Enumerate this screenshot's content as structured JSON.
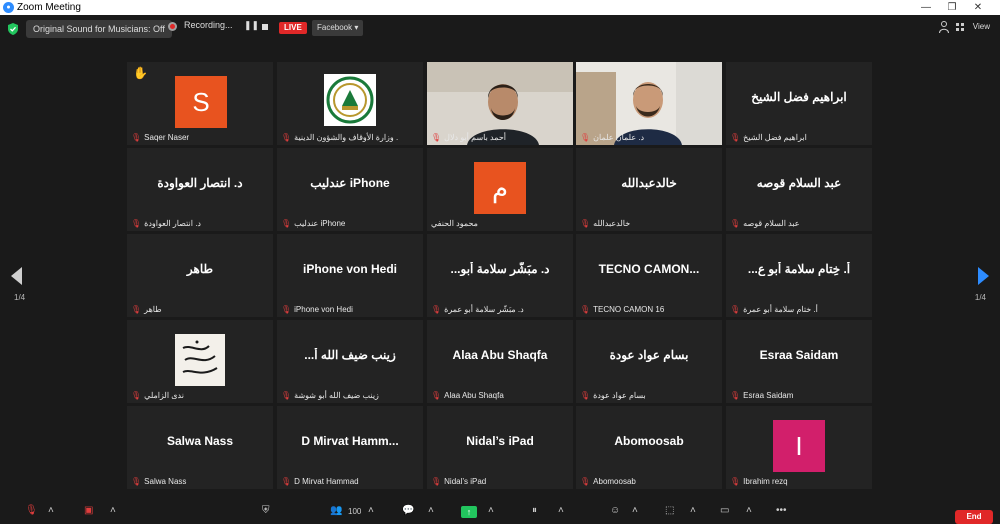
{
  "window": {
    "title": "Zoom Meeting"
  },
  "topbar": {
    "sound_label": "Original Sound for Musicians: Off",
    "recording_label": "Recording...",
    "pause_glyph": "❚❚",
    "live_label": "LIVE",
    "facebook_label": "Facebook ▾",
    "view_label": "View"
  },
  "grid": {
    "page_left": "1/4",
    "page_right": "1/4",
    "tiles": [
      {
        "label": "Saqer Naser",
        "avatar_letter": "S",
        "avatar_color": "#e8531f"
      },
      {
        "label": "وزارة الأوقاف والشؤون الدينية ."
      },
      {
        "label": "أحمد باسم أبو دلال"
      },
      {
        "label": "د. علمان علمان"
      },
      {
        "big": "ابراهيم فضل الشيخ",
        "label": "ابراهيم فضل الشيخ"
      },
      {
        "big": "د. انتصار العواودة",
        "label": "د. انتصار العواودة"
      },
      {
        "big": "عندليب iPhone",
        "label": "عندليب iPhone"
      },
      {
        "label": "محمود الحنفي",
        "avatar_letter": "م",
        "avatar_color": "#e8531f"
      },
      {
        "big": "خالدعبدالله",
        "label": "خالدعبدالله"
      },
      {
        "big": "عبد السلام قوصه",
        "label": "عبد السلام قوصه"
      },
      {
        "big": "طاهر",
        "label": "طاهر"
      },
      {
        "big": "iPhone von Hedi",
        "label": "iPhone von Hedi"
      },
      {
        "big": "...د. مبَشّر سلامة أبو",
        "label": "د. مبَشّر سلامة أبو عمرة"
      },
      {
        "big": "TECNO CAMON...",
        "label": "TECNO CAMON 16"
      },
      {
        "big": "...أ. خِتام سلامة أبو ع",
        "label": "أ. ختام سلامة أبو عمرة"
      },
      {
        "label": "ندى الزاملي"
      },
      {
        "big": "...زينب ضيف الله أ",
        "label": "زينب ضيف الله أبو شوشة"
      },
      {
        "big": "Alaa Abu Shaqfa",
        "label": "Alaa Abu Shaqfa"
      },
      {
        "big": "بسام عواد عودة",
        "label": "بسام عواد عودة"
      },
      {
        "big": "Esraa  Saidam",
        "label": "Esraa  Saidam"
      },
      {
        "big": "Salwa Nass",
        "label": "Salwa Nass"
      },
      {
        "big": "D Mirvat Hamm...",
        "label": "D Mirvat Hammad"
      },
      {
        "big": "Nidal’s iPad",
        "label": "Nidal’s iPad"
      },
      {
        "big": "Abomoosab",
        "label": "Abomoosab"
      },
      {
        "label": "Ibrahim rezq",
        "avatar_letter": "I",
        "avatar_color": "#d21f6b"
      }
    ]
  },
  "toolbar": {
    "participants_count": "100",
    "end_label": "End"
  }
}
